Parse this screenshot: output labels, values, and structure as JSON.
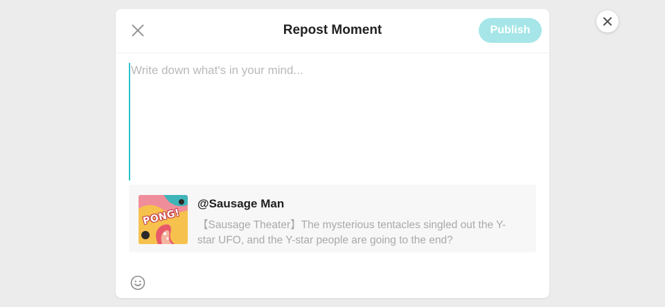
{
  "dialog": {
    "title": "Repost Moment",
    "publish_label": "Publish",
    "close_icon": "close-icon"
  },
  "composer": {
    "value": "",
    "placeholder": "Write down what's in your mind..."
  },
  "quoted_post": {
    "author": "@Sausage Man",
    "text": "【Sausage Theater】The mysterious tentacles singled out the Y-star UFO, and the Y-star people are going to the end?",
    "thumbnail_text": "PONG!"
  },
  "toolbar": {
    "emoji_icon": "smiley-icon"
  },
  "overlay": {
    "close_icon": "close-icon"
  },
  "colors": {
    "accent": "#2bc1c8",
    "publish_disabled": "#a6e6e8",
    "background": "#ececec"
  }
}
